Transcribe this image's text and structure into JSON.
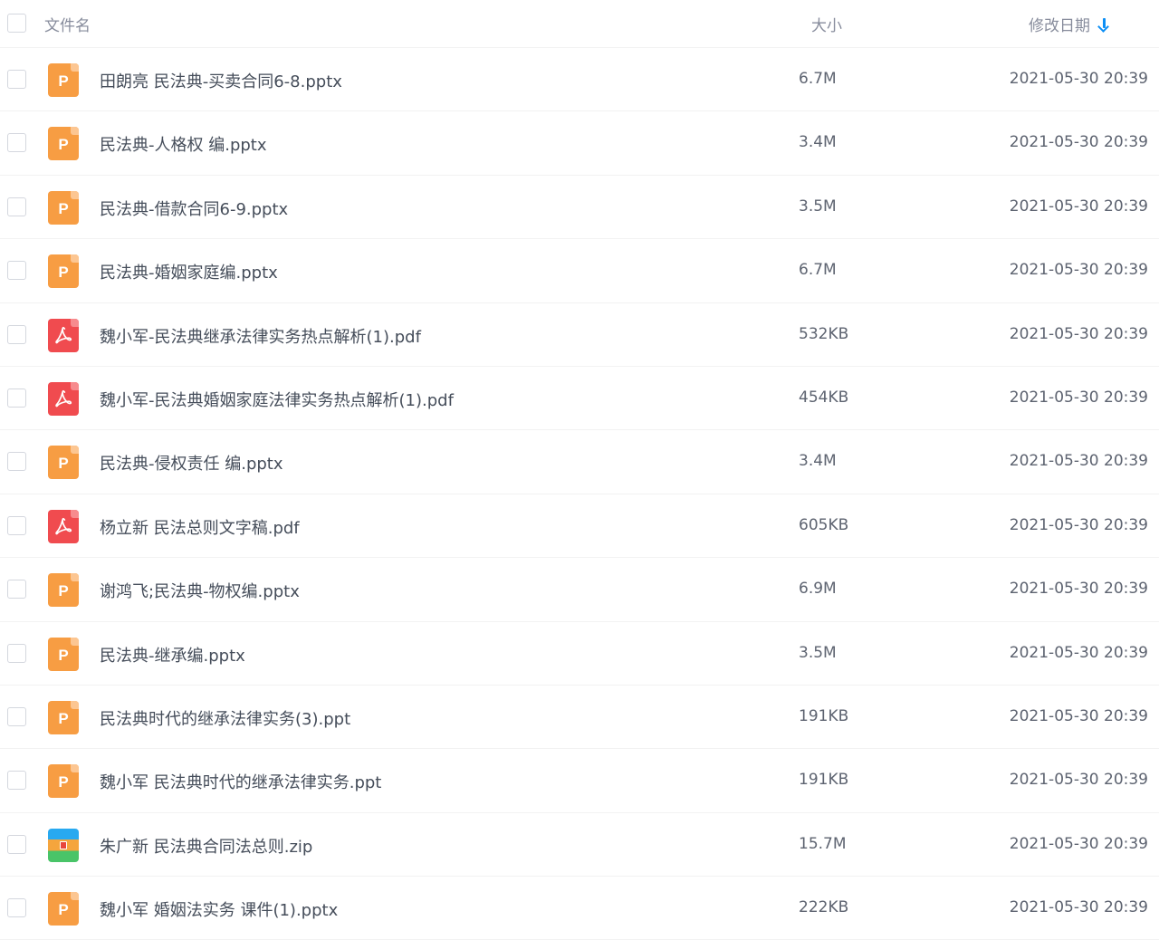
{
  "header": {
    "name_label": "文件名",
    "size_label": "大小",
    "date_label": "修改日期",
    "sort_icon": "arrow-down-icon",
    "accent_color": "#0d8ff5"
  },
  "files": [
    {
      "name": "田朗亮 民法典-买卖合同6-8.pptx",
      "size": "6.7M",
      "date": "2021-05-30 20:39",
      "type": "ppt",
      "icon_letter": "P"
    },
    {
      "name": "民法典-人格权 编.pptx",
      "size": "3.4M",
      "date": "2021-05-30 20:39",
      "type": "ppt",
      "icon_letter": "P"
    },
    {
      "name": "民法典-借款合同6-9.pptx",
      "size": "3.5M",
      "date": "2021-05-30 20:39",
      "type": "ppt",
      "icon_letter": "P"
    },
    {
      "name": "民法典-婚姻家庭编.pptx",
      "size": "6.7M",
      "date": "2021-05-30 20:39",
      "type": "ppt",
      "icon_letter": "P"
    },
    {
      "name": "魏小军-民法典继承法律实务热点解析(1).pdf",
      "size": "532KB",
      "date": "2021-05-30 20:39",
      "type": "pdf",
      "icon_letter": ""
    },
    {
      "name": "魏小军-民法典婚姻家庭法律实务热点解析(1).pdf",
      "size": "454KB",
      "date": "2021-05-30 20:39",
      "type": "pdf",
      "icon_letter": ""
    },
    {
      "name": "民法典-侵权责任 编.pptx",
      "size": "3.4M",
      "date": "2021-05-30 20:39",
      "type": "ppt",
      "icon_letter": "P"
    },
    {
      "name": "杨立新 民法总则文字稿.pdf",
      "size": "605KB",
      "date": "2021-05-30 20:39",
      "type": "pdf",
      "icon_letter": ""
    },
    {
      "name": "谢鸿飞;民法典-物权编.pptx",
      "size": "6.9M",
      "date": "2021-05-30 20:39",
      "type": "ppt",
      "icon_letter": "P"
    },
    {
      "name": "民法典-继承编.pptx",
      "size": "3.5M",
      "date": "2021-05-30 20:39",
      "type": "ppt",
      "icon_letter": "P"
    },
    {
      "name": "民法典时代的继承法律实务(3).ppt",
      "size": "191KB",
      "date": "2021-05-30 20:39",
      "type": "ppt",
      "icon_letter": "P"
    },
    {
      "name": "魏小军 民法典时代的继承法律实务.ppt",
      "size": "191KB",
      "date": "2021-05-30 20:39",
      "type": "ppt",
      "icon_letter": "P"
    },
    {
      "name": "朱广新 民法典合同法总则.zip",
      "size": "15.7M",
      "date": "2021-05-30 20:39",
      "type": "zip",
      "icon_letter": ""
    },
    {
      "name": "魏小军 婚姻法实务 课件(1).pptx",
      "size": "222KB",
      "date": "2021-05-30 20:39",
      "type": "ppt",
      "icon_letter": "P"
    }
  ]
}
